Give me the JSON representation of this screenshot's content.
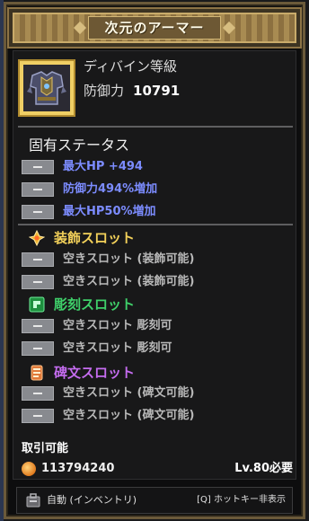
{
  "window": {
    "title": "次元のアーマー"
  },
  "item": {
    "grade": "ディバイン等級",
    "defense_label": "防御力",
    "defense_value": "10791",
    "icon": "armor-icon"
  },
  "inherent": {
    "title": "固有ステータス",
    "stats": [
      {
        "text": "最大HP +494"
      },
      {
        "text": "防御力494%増加"
      },
      {
        "text": "最大HP50%増加"
      }
    ]
  },
  "slots": {
    "accessory": {
      "title": "装飾スロット",
      "color": "#f3d15a",
      "icon": "accessory-slot-icon",
      "entries": [
        "空きスロット (装飾可能)",
        "空きスロット (装飾可能)"
      ]
    },
    "engraving": {
      "title": "彫刻スロット",
      "color": "#3fd06a",
      "icon": "engraving-slot-icon",
      "entries": [
        "空きスロット 彫刻可",
        "空きスロット 彫刻可"
      ]
    },
    "inscription": {
      "title": "碑文スロット",
      "color": "#c56cf0",
      "icon": "inscription-slot-icon",
      "entries": [
        "空きスロット (碑文可能)",
        "空きスロット (碑文可能)"
      ]
    }
  },
  "trade": {
    "label": "取引可能",
    "gold": "113794240",
    "level_req": "Lv.80必要"
  },
  "footer": {
    "auto_label": "自動 (インベントリ)",
    "hotkey_label": "[Q] ホットキー非表示"
  },
  "colors": {
    "stat_blue": "#7c8cff",
    "frame_gold": "#8d7446"
  }
}
